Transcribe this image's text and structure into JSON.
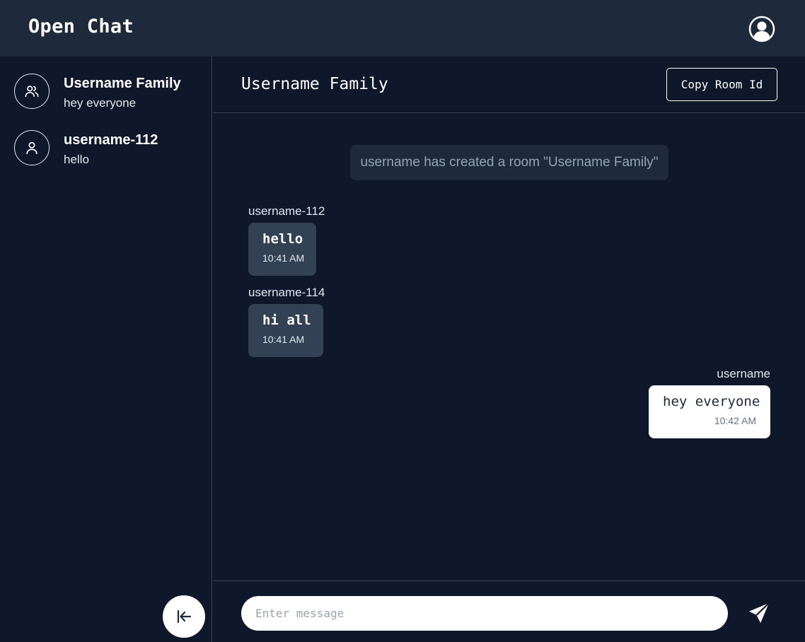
{
  "app": {
    "title": "Open Chat"
  },
  "header": {
    "user_icon": "user-circle-icon"
  },
  "sidebar": {
    "rooms": [
      {
        "name": "Username Family",
        "preview": "hey everyone",
        "icon": "group-icon"
      },
      {
        "name": "username-112",
        "preview": "hello",
        "icon": "user-icon"
      }
    ],
    "collapse_icon": "collapse-left-icon"
  },
  "chat": {
    "title": "Username Family",
    "copy_label": "Copy Room Id",
    "system_message": "username has created a room \"Username Family\"",
    "messages": [
      {
        "sender": "username-112",
        "text": "hello",
        "time": "10:41 AM",
        "mine": false
      },
      {
        "sender": "username-114",
        "text": "hi all",
        "time": "10:41 AM",
        "mine": false
      },
      {
        "sender": "username",
        "text": "hey everyone",
        "time": "10:42 AM",
        "mine": true
      }
    ]
  },
  "composer": {
    "placeholder": "Enter message",
    "value": "",
    "send_icon": "send-icon"
  },
  "colors": {
    "background": "#0f172a",
    "topbar": "#1e293b",
    "incoming_bubble": "#334155",
    "outgoing_bubble": "#ffffff",
    "system_bubble": "#1e293b"
  }
}
